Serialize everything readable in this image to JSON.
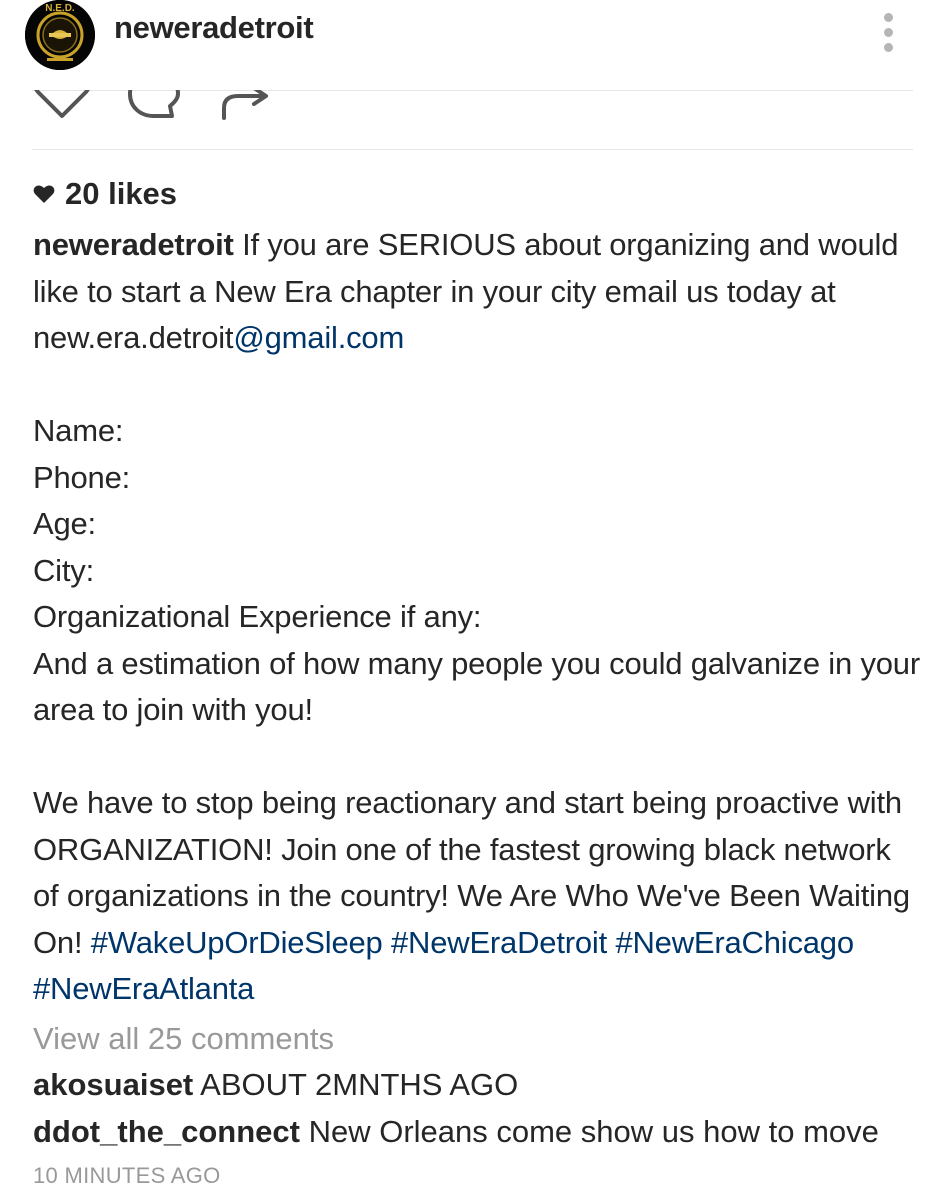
{
  "post": {
    "username": "neweradetroit",
    "likes_label": "20 likes",
    "caption": {
      "username": "neweradetroit",
      "line1_rest": " If you are SERIOUS about organizing and would like to start a New Era chapter in your city email us today at ",
      "email_local": "new.era.detroit",
      "email_domain": "@gmail.com",
      "form_fields": [
        "Name:",
        "Phone:",
        "Age:",
        "City:",
        "Organizational Experience if any:",
        "And a estimation of how many people you could galvanize in your area to join with you!"
      ],
      "closing_text": "We have to stop being reactionary and start being proactive with ORGANIZATION! Join one of the fastest growing black network of organizations in the country! We Are Who We've Been Waiting On! ",
      "hashtags": [
        "#WakeUpOrDieSleep",
        "#NewEraDetroit",
        "#NewEraChicago",
        "#NewEraAtlanta"
      ]
    },
    "view_all_comments": "View all 25 comments",
    "comments": [
      {
        "username": "akosuaiset",
        "text": " ABOUT 2MNTHS AGO"
      },
      {
        "username": "ddot_the_connect",
        "text": " New Orleans come show us how to move"
      }
    ],
    "timestamp": "10 MINUTES AGO",
    "avatar_text": "N.E.D.",
    "icons": {
      "like": "heart-outline-icon",
      "comment": "comment-bubble-icon",
      "share": "share-arrow-icon",
      "more": "vertical-dots-icon",
      "likes_heart": "heart-filled-icon"
    },
    "colors": {
      "text": "#262626",
      "link": "#003569",
      "muted": "#999999",
      "avatar_gold": "#c9a227"
    }
  }
}
